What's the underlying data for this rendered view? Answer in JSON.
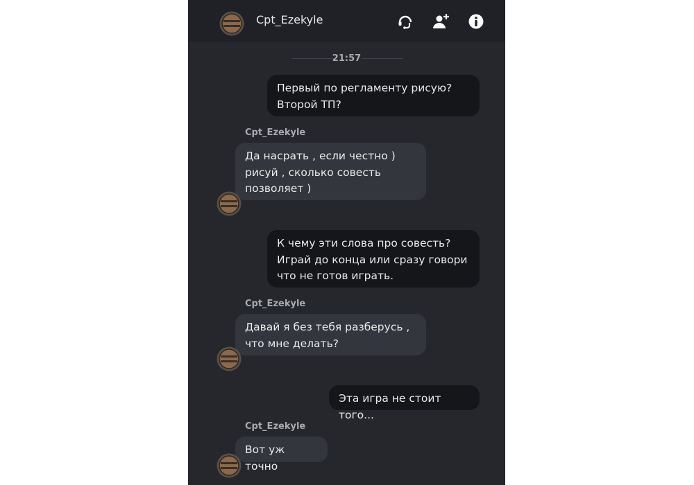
{
  "header": {
    "contact_name": "Cpt_Ezekyle",
    "icons": [
      "support-icon",
      "add-user-icon",
      "info-icon"
    ]
  },
  "chat": {
    "time_divider": "21:57",
    "messages": [
      {
        "direction": "out",
        "text": "Первый по регламенту рисую?\nВторой ТП?"
      },
      {
        "direction": "in",
        "sender": "Cpt_Ezekyle",
        "text": "Да насрать , если честно )\nрисуй , сколько совесть\nпозволяет )"
      },
      {
        "direction": "out",
        "text": "К чему эти слова про совесть?\nИграй до конца или сразу говори\nчто не готов играть."
      },
      {
        "direction": "in",
        "sender": "Cpt_Ezekyle",
        "text": "Давай я без тебя разберусь ,\nчто мне делать?"
      },
      {
        "direction": "out",
        "text": "Эта игра не стоит того..."
      },
      {
        "direction": "in",
        "sender": "Cpt_Ezekyle",
        "text": "Вот уж точно"
      }
    ]
  },
  "colors": {
    "chat_background": "#25272d",
    "header_background": "#1f2126",
    "outgoing_bubble": "#15161a",
    "incoming_bubble": "#34363d",
    "meta_text": "#a8aab0"
  }
}
